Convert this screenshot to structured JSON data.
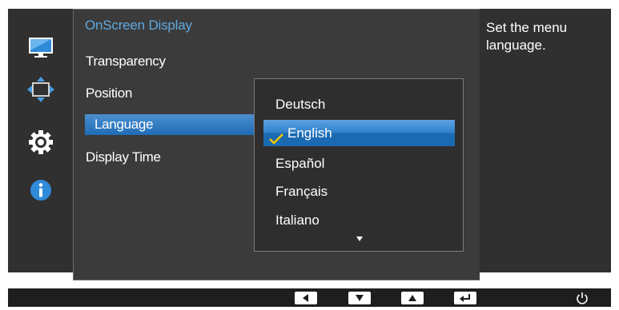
{
  "panel": {
    "title": "OnScreen Display"
  },
  "menu": {
    "items": [
      "Transparency",
      "Position",
      "Language",
      "Display Time"
    ],
    "selected": "Language"
  },
  "dropdown": {
    "options": [
      "Deutsch",
      "English",
      "Español",
      "Français",
      "Italiano"
    ],
    "selected": "English",
    "has_more": true
  },
  "help": {
    "text": "Set the menu language."
  },
  "sidebar": {
    "icons": [
      "picture-icon",
      "position-icon",
      "settings-gear-icon",
      "info-icon"
    ]
  },
  "bottom_bar": {
    "keys": [
      "left-arrow-key-icon",
      "down-arrow-key-icon",
      "up-arrow-key-icon",
      "enter-key-icon",
      "power-icon"
    ]
  },
  "colors": {
    "accent": "#5fa8e0",
    "selection": "#1f6cb5",
    "panel_bg": "#3b3b3b",
    "background": "#303030"
  }
}
